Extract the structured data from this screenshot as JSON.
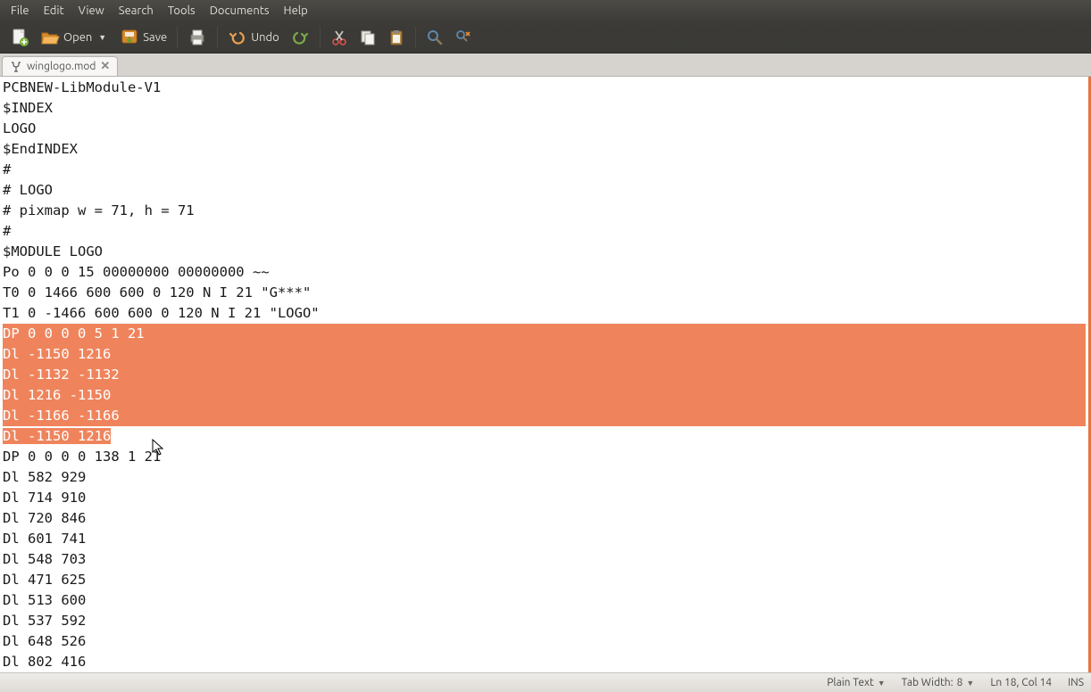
{
  "menubar": [
    "File",
    "Edit",
    "View",
    "Search",
    "Tools",
    "Documents",
    "Help"
  ],
  "toolbar": {
    "open_label": "Open",
    "save_label": "Save",
    "undo_label": "Undo"
  },
  "tab": {
    "name": "winglogo.mod"
  },
  "editor": {
    "before": "PCBNEW-LibModule-V1\n$INDEX\nLOGO\n$EndINDEX\n#\n# LOGO\n# pixmap w = 71, h = 71\n#\n$MODULE LOGO\nPo 0 0 0 15 00000000 00000000 ~~\nT0 0 1466 600 600 0 120 N I 21 \"G***\"\nT1 0 -1466 600 600 0 120 N I 21 \"LOGO\"",
    "selected": "DP 0 0 0 0 5 1 21\nDl -1150 1216\nDl -1132 -1132\nDl 1216 -1150\nDl -1166 -1166\nDl -1150 1216",
    "after": "DP 0 0 0 0 138 1 21\nDl 582 929\nDl 714 910\nDl 720 846\nDl 601 741\nDl 548 703\nDl 471 625\nDl 513 600\nDl 537 592\nDl 648 526\nDl 802 416"
  },
  "statusbar": {
    "syntax": "Plain Text",
    "tabwidth_label": "Tab Width:",
    "tabwidth_value": "8",
    "position": "Ln 18, Col 14",
    "mode": "INS"
  }
}
